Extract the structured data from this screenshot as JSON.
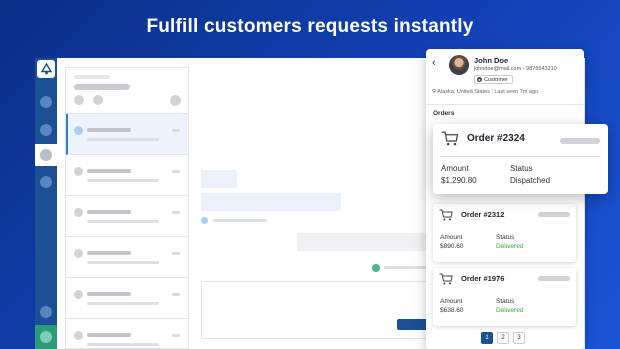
{
  "headline": "Fulfill customers requests instantly",
  "customer": {
    "name": "John Doe",
    "email": "johndoe@mail.com",
    "phone": "9876543210",
    "badge": "Customer",
    "location": "Alaska, United States",
    "last_seen": "Last seen 7m ago"
  },
  "orders_title": "Orders",
  "orders": [
    {
      "number": "Order #2324",
      "amount_label": "Amount",
      "amount": "$1,290.80",
      "status_label": "Status",
      "status": "Dispatched"
    },
    {
      "number": "Order #2312",
      "amount_label": "Amount",
      "amount": "$890.60",
      "status_label": "Status",
      "status": "Delivered"
    },
    {
      "number": "Order #1976",
      "amount_label": "Amount",
      "amount": "$638.60",
      "status_label": "Status",
      "status": "Delivered"
    }
  ],
  "pagination": [
    "1",
    "2",
    "3"
  ],
  "colors": {
    "accent": "#1b4f96",
    "delivered": "#3aa53a",
    "rail_bottom": "#2b9b7a"
  }
}
